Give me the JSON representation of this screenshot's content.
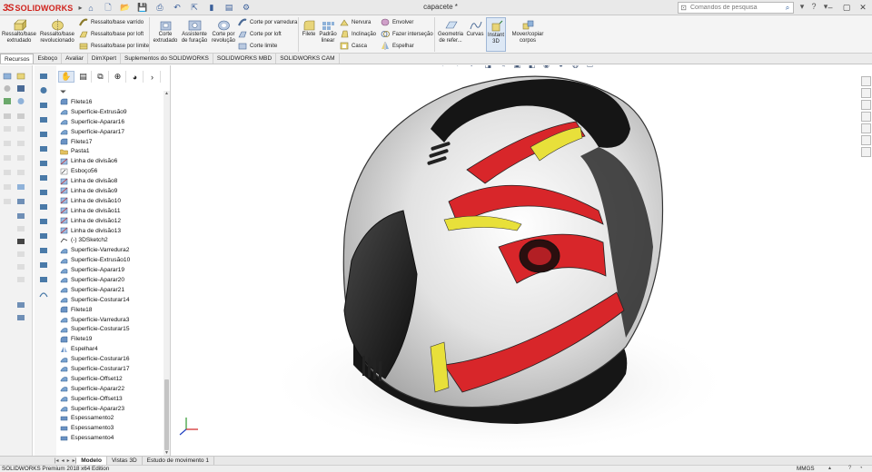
{
  "app": {
    "brand": "SOLIDWORKS",
    "logo_mark": "3S",
    "document_title": "capacete *",
    "edition": "SOLIDWORKS Premium 2018 x64 Edition",
    "units": "MMGS"
  },
  "search": {
    "placeholder": "Comandos de pesquisa"
  },
  "ribbon": {
    "big_buttons": [
      {
        "label": "Ressalto/base extrudado"
      },
      {
        "label": "Ressalto/base revolucionado"
      },
      {
        "label": "Corte extrudado"
      },
      {
        "label": "Assistente de furação"
      },
      {
        "label": "Corte por revolução"
      },
      {
        "label": "Filete"
      },
      {
        "label": "Padrão linear"
      },
      {
        "label": "Geometria de refer..."
      },
      {
        "label": "Curvas"
      },
      {
        "label": "Instant 3D"
      },
      {
        "label": "Mover/copiar corpos"
      }
    ],
    "small_buttons": [
      {
        "label": "Ressalto/base varrido"
      },
      {
        "label": "Ressalto/base por loft"
      },
      {
        "label": "Ressalto/base por limite"
      },
      {
        "label": "Corte por varredura"
      },
      {
        "label": "Corte por loft"
      },
      {
        "label": "Corte limite"
      },
      {
        "label": "Nervura"
      },
      {
        "label": "Inclinação"
      },
      {
        "label": "Casca"
      },
      {
        "label": "Envolver"
      },
      {
        "label": "Fazer interseção"
      },
      {
        "label": "Espelhar"
      }
    ]
  },
  "tabs": [
    "Recursos",
    "Esboço",
    "Avaliar",
    "DimXpert",
    "Suplementos do SOLIDWORKS",
    "SOLIDWORKS MBD",
    "SOLIDWORKS CAM"
  ],
  "feature_tree": [
    {
      "label": "Filete16",
      "type": "fillet"
    },
    {
      "label": "Superfície-Extrusão9",
      "type": "surface"
    },
    {
      "label": "Superfície-Aparar16",
      "type": "surface"
    },
    {
      "label": "Superfície-Aparar17",
      "type": "surface"
    },
    {
      "label": "Filete17",
      "type": "fillet"
    },
    {
      "label": "Pasta1",
      "type": "folder"
    },
    {
      "label": "Linha de divisão6",
      "type": "split"
    },
    {
      "label": "Esboço56",
      "type": "sketch"
    },
    {
      "label": "Linha de divisão8",
      "type": "split"
    },
    {
      "label": "Linha de divisão9",
      "type": "split"
    },
    {
      "label": "Linha de divisão10",
      "type": "split"
    },
    {
      "label": "Linha de divisão11",
      "type": "split"
    },
    {
      "label": "Linha de divisão12",
      "type": "split"
    },
    {
      "label": "Linha de divisão13",
      "type": "split"
    },
    {
      "label": "(-) 3DSketch2",
      "type": "sketch3d"
    },
    {
      "label": "Superfície-Varredura2",
      "type": "surface"
    },
    {
      "label": "Superfície-Extrusão10",
      "type": "surface"
    },
    {
      "label": "Superfície-Aparar19",
      "type": "surface"
    },
    {
      "label": "Superfície-Aparar20",
      "type": "surface"
    },
    {
      "label": "Superfície-Aparar21",
      "type": "surface"
    },
    {
      "label": "Superfície-Costurar14",
      "type": "surface"
    },
    {
      "label": "Filete18",
      "type": "fillet"
    },
    {
      "label": "Superfície-Varredura3",
      "type": "surface"
    },
    {
      "label": "Superfície-Costurar15",
      "type": "surface"
    },
    {
      "label": "Filete19",
      "type": "fillet"
    },
    {
      "label": "Espelhar4",
      "type": "mirror"
    },
    {
      "label": "Superfície-Costurar16",
      "type": "surface"
    },
    {
      "label": "Superfície-Costurar17",
      "type": "surface"
    },
    {
      "label": "Superfície-Offset12",
      "type": "surface"
    },
    {
      "label": "Superfície-Aparar22",
      "type": "surface"
    },
    {
      "label": "Superfície-Offset13",
      "type": "surface"
    },
    {
      "label": "Superfície-Aparar23",
      "type": "surface"
    },
    {
      "label": "Espessamento2",
      "type": "thicken"
    },
    {
      "label": "Espessamento3",
      "type": "thicken"
    },
    {
      "label": "Espessamento4",
      "type": "thicken"
    }
  ],
  "bottom_tabs": [
    "Modelo",
    "Vistas 3D",
    "Estudo de movimento 1"
  ],
  "colors": {
    "brand_red": "#d0221c",
    "helmet_red": "#d8262a",
    "helmet_yellow": "#e8e03a",
    "visor": "#1c1c1c"
  }
}
